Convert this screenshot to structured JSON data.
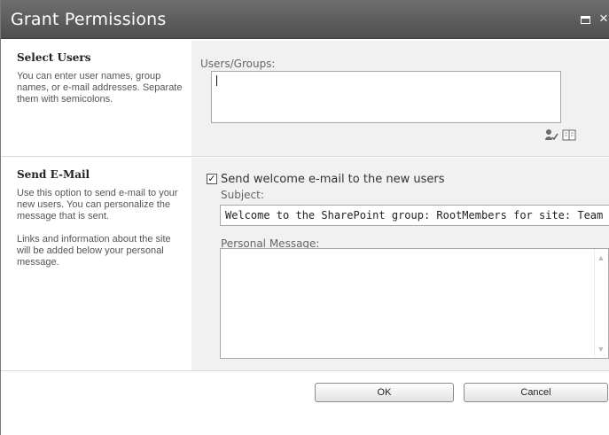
{
  "dialog": {
    "title": "Grant Permissions",
    "icons": [
      "maximize-icon",
      "close-icon"
    ],
    "close_glyph": "×"
  },
  "select_users": {
    "heading": "Select Users",
    "description": "You can enter user names, group names, or e-mail addresses. Separate them with semicolons.",
    "field_label": "Users/Groups:",
    "value": "",
    "icons": [
      "check-names-icon",
      "address-book-icon"
    ]
  },
  "send_email": {
    "heading": "Send E-Mail",
    "description": "Use this option to send e-mail to your new users. You can personalize the message that is sent.",
    "description2": "Links and information about the site will be added below your personal message.",
    "checkbox_label": "Send welcome e-mail to the new users",
    "checkbox_checked": true,
    "checkbox_glyph": "✓",
    "subject_label": "Subject:",
    "subject_value": "Welcome to the SharePoint group: RootMembers for site: Team Col",
    "message_label": "Personal Message:",
    "message_value": ""
  },
  "buttons": {
    "ok": "OK",
    "cancel": "Cancel"
  },
  "colors": {
    "titlebar": "#5a5a5a",
    "right_panel": "#f1f1f1"
  }
}
